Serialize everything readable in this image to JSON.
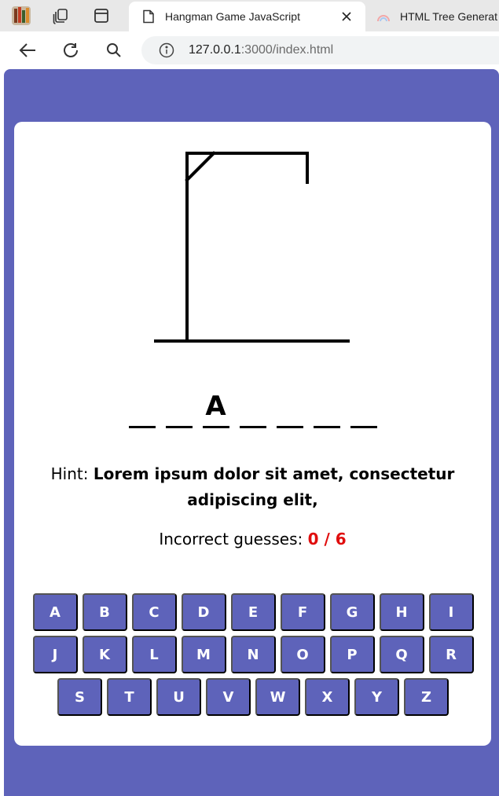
{
  "browser": {
    "tabs": [
      {
        "title": "Hangman Game JavaScript",
        "active": true
      },
      {
        "title": "HTML Tree Generat",
        "active": false
      }
    ],
    "url": {
      "host": "127.0.0.1",
      "rest": ":3000/index.html"
    },
    "icons": [
      "profile-icon",
      "workspaces-icon",
      "tab-actions-icon",
      "page-favicon-icon",
      "close-tab-icon",
      "rainbow-favicon-icon",
      "back-icon",
      "reload-icon",
      "search-icon",
      "site-info-icon"
    ]
  },
  "game": {
    "word_slots": [
      "",
      "",
      "A",
      "",
      "",
      "",
      ""
    ],
    "hint_label": "Hint:",
    "hint_text": "Lorem ipsum dolor sit amet, consectetur adipiscing elit,",
    "guesses_label": "Incorrect guesses:",
    "guesses_count": "0 / 6",
    "keyboard_rows": [
      [
        "A",
        "B",
        "C",
        "D",
        "E",
        "F",
        "G",
        "H",
        "I"
      ],
      [
        "J",
        "K",
        "L",
        "M",
        "N",
        "O",
        "P",
        "Q",
        "R"
      ],
      [
        "S",
        "T",
        "U",
        "V",
        "W",
        "X",
        "Y",
        "Z"
      ]
    ]
  },
  "colors": {
    "page_background": "#5e63ba",
    "key_background": "#5e63ba",
    "incorrect_count": "#e00d0d"
  }
}
